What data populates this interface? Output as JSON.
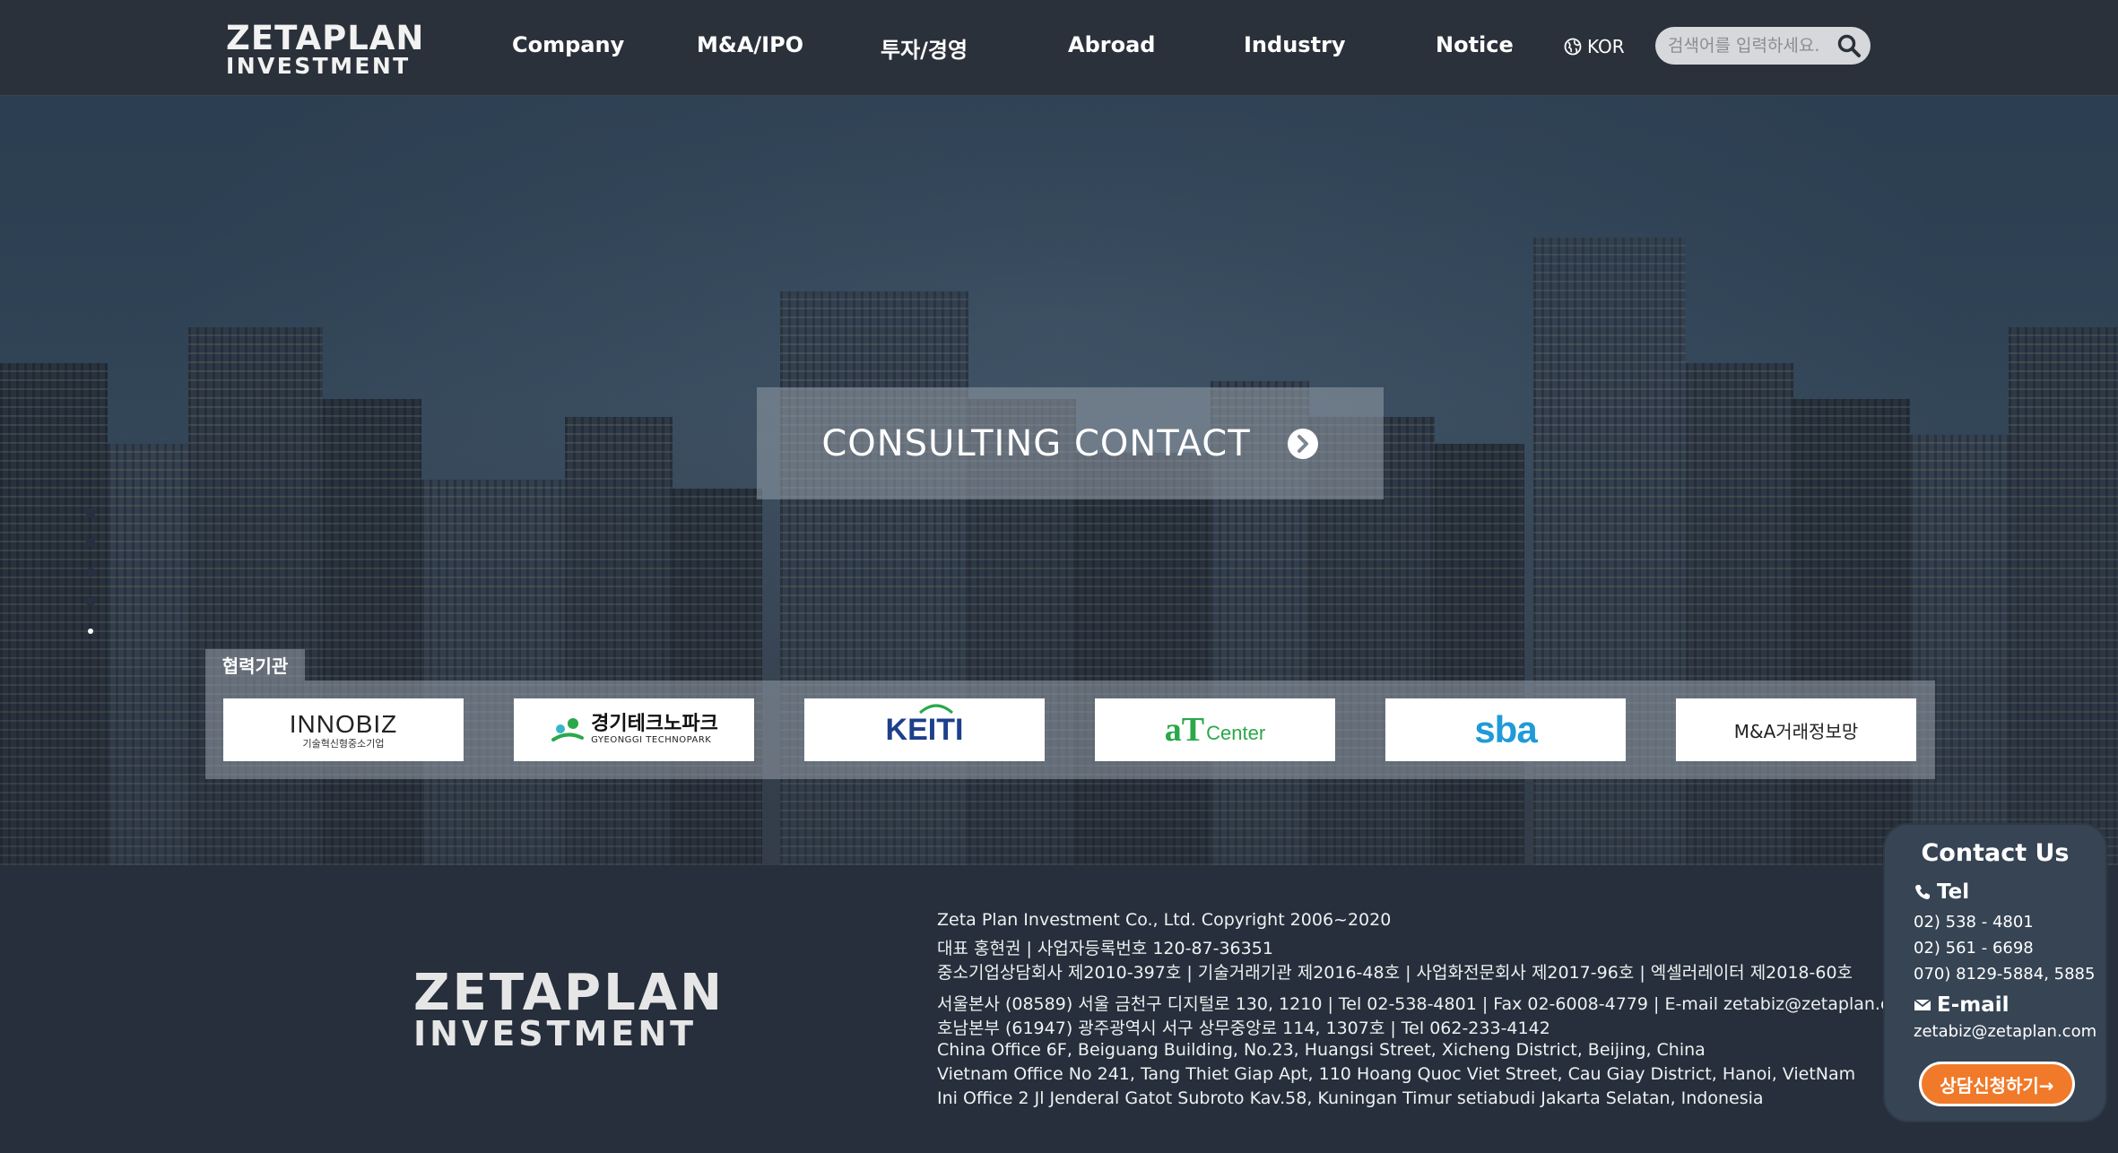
{
  "header": {
    "logo_line1": "ZETAPLAN",
    "logo_line2": "INVESTMENT",
    "nav": [
      "Company",
      "M&A/IPO",
      "투자/경영",
      "Abroad",
      "Industry",
      "Notice"
    ],
    "lang_label": "KOR",
    "search_placeholder": "검색어를 입력하세요."
  },
  "hero": {
    "consult_label": "CONSULTING CONTACT",
    "slides_total": 5,
    "slide_active_index": 5
  },
  "partners": {
    "tab_label": "협력기관",
    "items": [
      {
        "name": "INNOBIZ",
        "sub": "기술혁신형중소기업"
      },
      {
        "name": "경기테크노파크",
        "sub": "GYEONGGI TECHNOPARK"
      },
      {
        "name": "KEITI"
      },
      {
        "name": "aT",
        "sub": "Center"
      },
      {
        "name": "sba"
      },
      {
        "name": "M&A거래정보망"
      }
    ]
  },
  "footer": {
    "logo_line1": "ZETAPLAN",
    "logo_line2": "INVESTMENT",
    "lines": [
      "Zeta Plan Investment Co., Ltd. Copyright 2006~2020",
      "대표 홍현권 | 사업자등록번호 120-87-36351",
      "중소기업상담회사 제2010-397호 | 기술거래기관 제2016-48호 | 사업화전문회사 제2017-96호 | 엑셀러레이터 제2018-60호",
      "서울본사 (08589) 서울 금천구 디지털로 130, 1210 | Tel 02-538-4801 | Fax 02-6008-4779 | E-mail zetabiz@zetaplan.com",
      "호남본부 (61947) 광주광역시 서구 상무중앙로 114, 1307호 | Tel 062-233-4142",
      "China Office 6F, Beiguang Building, No.23, Huangsi Street, Xicheng District, Beijing, China",
      "Vietnam Office No 241, Tang Thiet Giap Apt, 110 Hoang Quoc Viet Street, Cau Giay District, Hanoi, VietNam",
      "Ini Office 2 Jl Jenderal Gatot Subroto Kav.58, Kuningan Timur setiabudi Jakarta Selatan, Indonesia"
    ]
  },
  "contact": {
    "title": "Contact Us",
    "tel_label": "Tel",
    "tel_values": [
      "02) 538 - 4801",
      "02) 561 - 6698",
      "070) 8129-5884, 5885"
    ],
    "email_label": "E-mail",
    "email_value": "zetabiz@zetaplan.com",
    "apply_label": "상담신청하기→"
  },
  "colors": {
    "header_bg": "#2b313a",
    "footer_bg": "#262f3b",
    "accent_orange": "#f07a2a",
    "overlay": "#969eaa"
  },
  "icons": [
    "globe-icon",
    "search-icon",
    "circle-chevron-right-icon",
    "phone-icon",
    "mail-icon"
  ]
}
